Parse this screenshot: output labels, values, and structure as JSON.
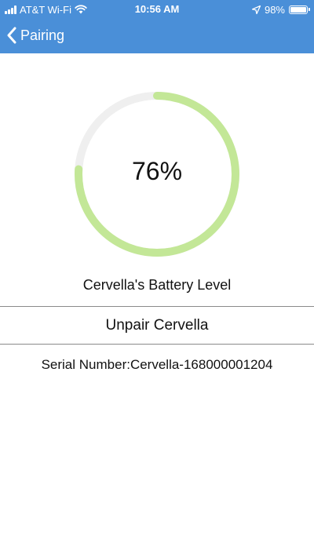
{
  "status_bar": {
    "carrier": "AT&T Wi-Fi",
    "time": "10:56 AM",
    "battery_percent": "98%",
    "battery_level": 0.98,
    "icons": [
      "signal-bars-icon",
      "wifi-icon",
      "location-arrow-icon",
      "battery-icon"
    ]
  },
  "nav": {
    "back_label": "Pairing",
    "back_icon": "chevron-left-icon"
  },
  "battery": {
    "percent_text": "76%",
    "level": 0.76,
    "label": "Cervella's Battery Level"
  },
  "unpair": {
    "label": "Unpair Cervella"
  },
  "serial": {
    "text": "Serial Number:Cervella-168000001204"
  },
  "colors": {
    "header": "#4a8fd8",
    "ring_fill": "#c3e797",
    "ring_track": "#efefef",
    "divider": "#8a8a8a"
  }
}
